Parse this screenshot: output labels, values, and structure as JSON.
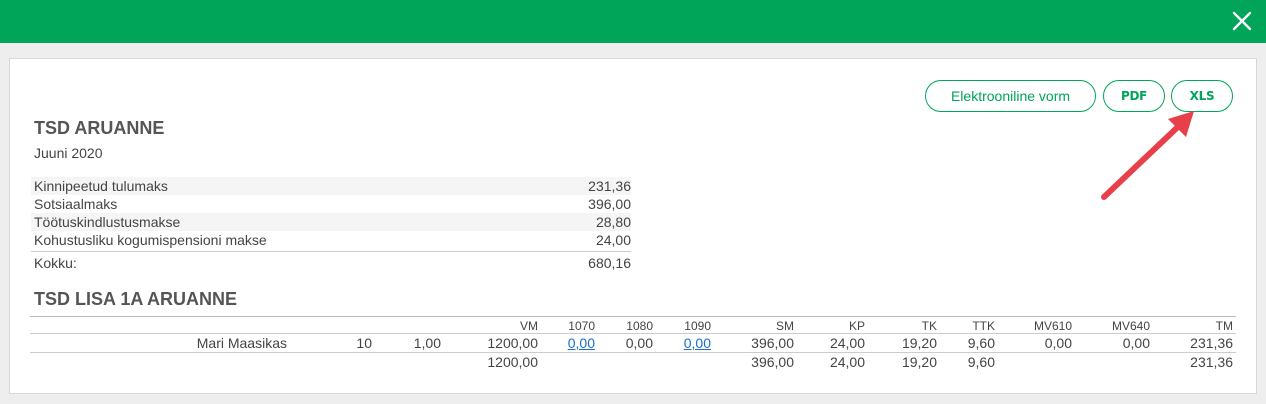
{
  "header": {
    "close_icon": "close-icon"
  },
  "buttons": {
    "electronic": "Elektrooniline vorm",
    "pdf": "PDF",
    "xls": "XLS"
  },
  "report": {
    "title": "TSD ARUANNE",
    "period": "Juuni 2020",
    "rows": [
      {
        "label": "Kinnipeetud tulumaks",
        "value": "231,36"
      },
      {
        "label": "Sotsiaalmaks",
        "value": "396,00"
      },
      {
        "label": "Töötuskindlustusmakse",
        "value": "28,80"
      },
      {
        "label": "Kohustusliku kogumispensioni makse",
        "value": "24,00"
      }
    ],
    "total_label": "Kokku:",
    "total_value": "680,16"
  },
  "annex": {
    "title": "TSD LISA 1A ARUANNE",
    "headers": [
      "VM",
      "1070",
      "1080",
      "1090",
      "SM",
      "KP",
      "TK",
      "TTK",
      "MV610",
      "MV640",
      "TM"
    ],
    "row": {
      "name": "Mari Maasikas",
      "code": "10",
      "rate": "1,00",
      "cells": [
        "1200,00",
        "0,00",
        "0,00",
        "0,00",
        "396,00",
        "24,00",
        "19,20",
        "9,60",
        "0,00",
        "0,00",
        "231,36"
      ]
    },
    "totals": [
      "1200,00",
      "",
      "",
      "",
      "396,00",
      "24,00",
      "19,20",
      "9,60",
      "",
      "",
      "231,36"
    ]
  },
  "colors": {
    "accent": "#00a55a",
    "link": "#1a6fc9",
    "arrow": "#e8404a"
  }
}
